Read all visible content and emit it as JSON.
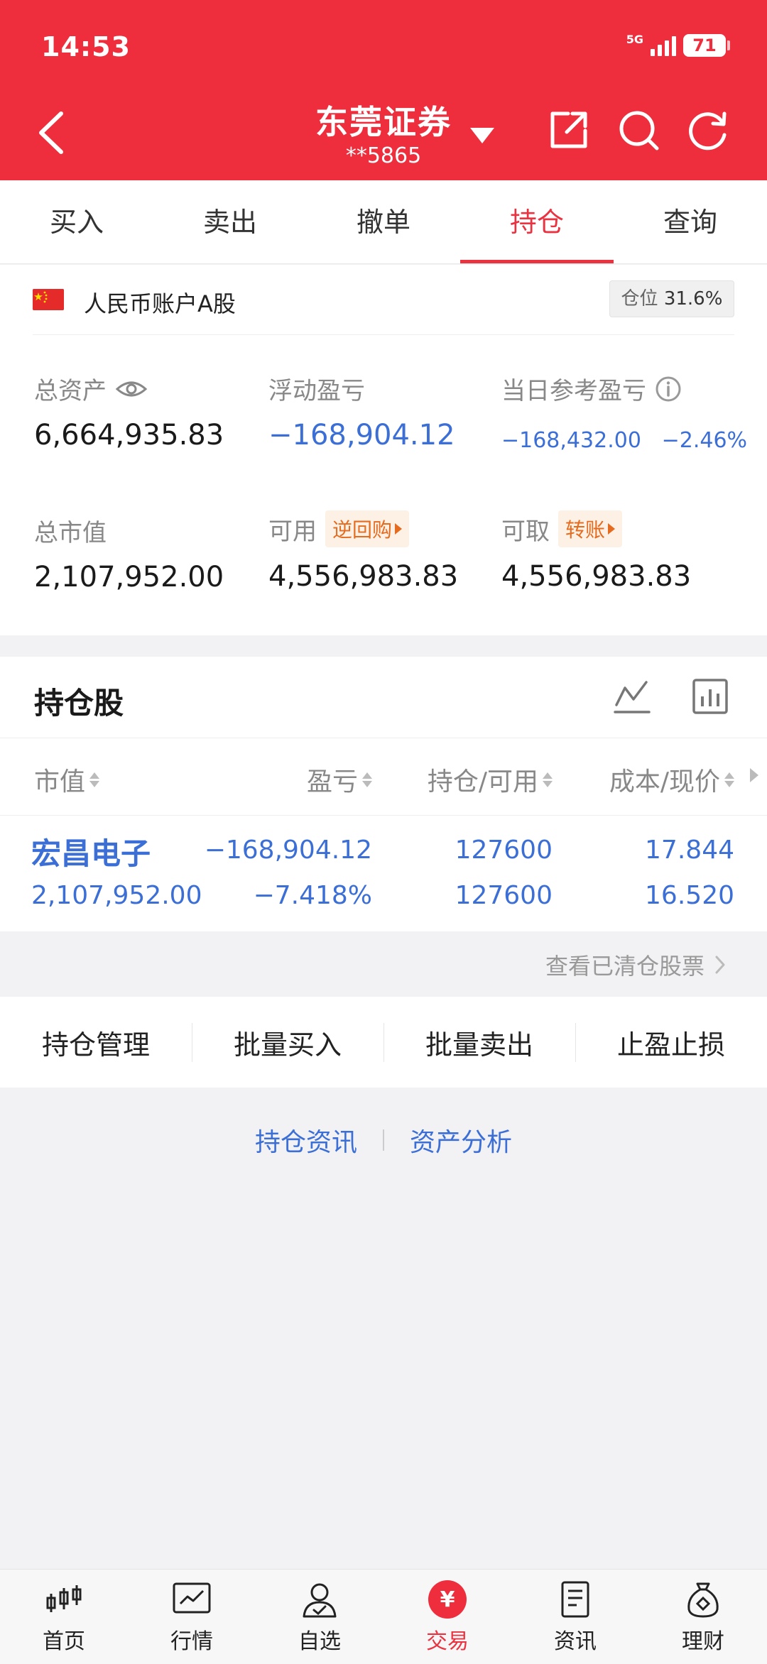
{
  "status_bar": {
    "time": "14:53",
    "network": "5G",
    "battery": "71"
  },
  "header": {
    "title": "东莞证券",
    "account": "**5865"
  },
  "tabs": [
    {
      "label": "买入"
    },
    {
      "label": "卖出"
    },
    {
      "label": "撤单"
    },
    {
      "label": "持仓",
      "active": true
    },
    {
      "label": "查询"
    }
  ],
  "account_summary": {
    "label": "人民币账户A股",
    "position_label": "仓位",
    "position_value": "31.6%",
    "total_assets_label": "总资产",
    "total_assets": "6,664,935.83",
    "floating_pl_label": "浮动盈亏",
    "floating_pl": "−168,904.12",
    "daily_pl_label": "当日参考盈亏",
    "daily_pl": "−168,432.00",
    "daily_pl_pct": "−2.46%",
    "market_value_label": "总市值",
    "market_value": "2,107,952.00",
    "available_label": "可用",
    "available_tag": "逆回购",
    "available": "4,556,983.83",
    "withdrawable_label": "可取",
    "withdrawable_tag": "转账",
    "withdrawable": "4,556,983.83"
  },
  "holdings": {
    "title": "持仓股",
    "columns": [
      "市值",
      "盈亏",
      "持仓/可用",
      "成本/现价"
    ],
    "rows": [
      {
        "name": "宏昌电子",
        "market_value": "2,107,952.00",
        "pl": "−168,904.12",
        "pl_pct": "−7.418%",
        "position": "127600",
        "available": "127600",
        "cost": "17.844",
        "price": "16.520"
      }
    ]
  },
  "cleared_link": "查看已清仓股票",
  "actions": [
    "持仓管理",
    "批量买入",
    "批量卖出",
    "止盈止损"
  ],
  "links": [
    "持仓资讯",
    "资产分析"
  ],
  "bottom_nav": [
    {
      "label": "首页",
      "icon": "candlestick-icon"
    },
    {
      "label": "行情",
      "icon": "trend-chart-icon"
    },
    {
      "label": "自选",
      "icon": "user-check-icon"
    },
    {
      "label": "交易",
      "icon": "yen-icon",
      "active": true
    },
    {
      "label": "资讯",
      "icon": "document-icon"
    },
    {
      "label": "理财",
      "icon": "money-bag-icon"
    }
  ],
  "colors": {
    "brand": "#ee2e3d",
    "loss": "#3c6fd6",
    "tag": "#e56b1f"
  }
}
